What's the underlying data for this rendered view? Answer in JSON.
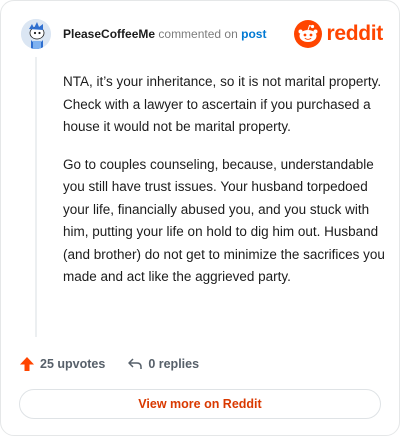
{
  "header": {
    "username": "PleaseCoffeeMe",
    "action_text": "commented on",
    "post_link": "post",
    "brand_name": "reddit",
    "brand_color": "#ff4500",
    "avatar_icon": "snoo-avatar-icon",
    "logo_icon": "reddit-logo-icon"
  },
  "comment": {
    "paragraphs": [
      "NTA, it’s your inheritance, so it is not marital property. Check with a lawyer to ascertain if you purchased a house it would not be marital property.",
      "Go to couples counseling, because, understandable you still have trust issues. Your husband torpedoed your life, financially abused you, and you stuck with him, putting your life on hold to dig him out. Husband (and brother) do not get to minimize the sacrifices you made and act like the aggrieved party."
    ]
  },
  "actions": {
    "upvotes": "25 upvotes",
    "replies": "0 replies",
    "upvote_icon": "upvote-arrow-icon",
    "reply_icon": "reply-arrow-icon",
    "upvote_color": "#ff4500"
  },
  "footer": {
    "view_more": "View more on Reddit"
  }
}
